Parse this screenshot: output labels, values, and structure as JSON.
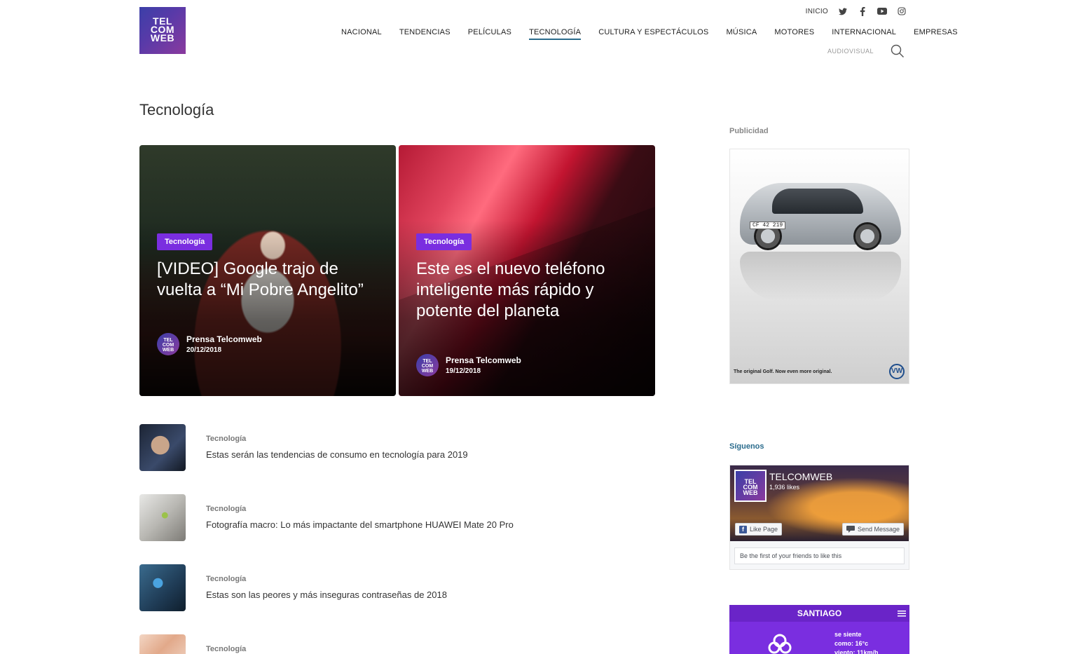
{
  "header": {
    "logo_lines": [
      "TEL",
      "COM",
      "WEB"
    ],
    "inicio": "INICIO",
    "social_icons": [
      "twitter-icon",
      "facebook-icon",
      "youtube-icon",
      "instagram-icon"
    ],
    "nav": [
      "NACIONAL",
      "TENDENCIAS",
      "PELÍCULAS",
      "TECNOLOGÍA",
      "CULTURA Y ESPECTÁCULOS",
      "MÚSICA",
      "MOTORES",
      "INTERNACIONAL",
      "EMPRESAS"
    ],
    "active_nav": "TECNOLOGÍA",
    "subnav": "AUDIOVISUAL",
    "accent_color": "#2a6b8c"
  },
  "page": {
    "title": "Tecnología"
  },
  "featured": [
    {
      "category": "Tecnología",
      "headline": "[VIDEO] Google trajo de vuelta a “Mi Pobre Angelito”",
      "author": "Prensa Telcomweb",
      "date": "20/12/2018"
    },
    {
      "category": "Tecnología",
      "headline": "Este es el nuevo teléfono inteligente más rápido y potente del planeta",
      "author": "Prensa Telcomweb",
      "date": "19/12/2018"
    }
  ],
  "badge_color": "#7a2ee0",
  "list": [
    {
      "category": "Tecnología",
      "title": "Estas serán las tendencias de consumo en tecnología para 2019"
    },
    {
      "category": "Tecnología",
      "title": "Fotografía macro: Lo más impactante del smartphone HUAWEI Mate 20 Pro"
    },
    {
      "category": "Tecnología",
      "title": "Estas son las peores y más inseguras contraseñas de 2018"
    },
    {
      "category": "Tecnología",
      "title": ""
    }
  ],
  "sidebar": {
    "ad_label": "Publicidad",
    "ad": {
      "plate": "CF 42 219",
      "caption": "The original Golf. Now even more original.",
      "brand": "VW"
    },
    "follow_label": "Síguenos",
    "facebook": {
      "name": "TELCOMWEB",
      "likes": "1,936 likes",
      "like_button": "Like Page",
      "message_button": "Send Message",
      "friends_text": "Be the first of your friends to like this"
    },
    "weather": {
      "city": "SANTIAGO",
      "line1": "se siente",
      "line2": "como: 16°c",
      "line3": "viento: 11km/h"
    }
  }
}
